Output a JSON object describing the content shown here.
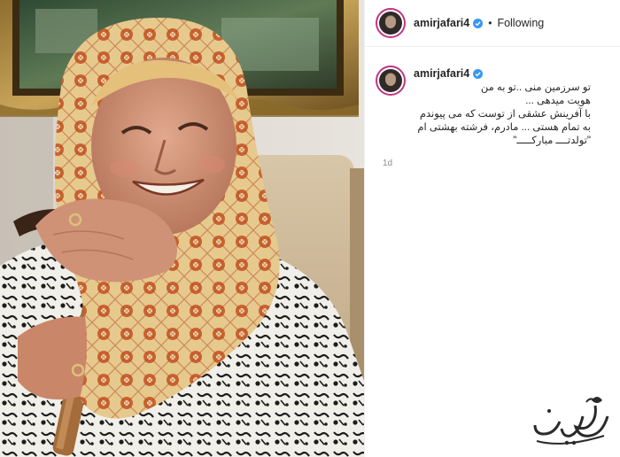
{
  "post": {
    "author": {
      "username": "amirjafari4",
      "verified": true,
      "avatar_icon": "profile-photo"
    },
    "follow_status": "Following",
    "separator": "•",
    "caption": {
      "lines": [
        "تو سرزمین منی ..تو به من",
        "هویت میدهی ...",
        "با آفرینش عشقی از توست که می پیوندم",
        "به تمام هستی ... مادرم، فرشته بهشتی ام",
        "\"تولدتــــ مبارکـــــ\""
      ]
    },
    "timestamp": "1d"
  },
  "colors": {
    "verified": "#3897f0",
    "avatar_ring": "#c13584",
    "divider": "#efefef",
    "muted_text": "#8e8e8e"
  },
  "photo": {
    "description_icon": "post-photo"
  },
  "watermark": {
    "icon": "site-logo-watermark"
  }
}
